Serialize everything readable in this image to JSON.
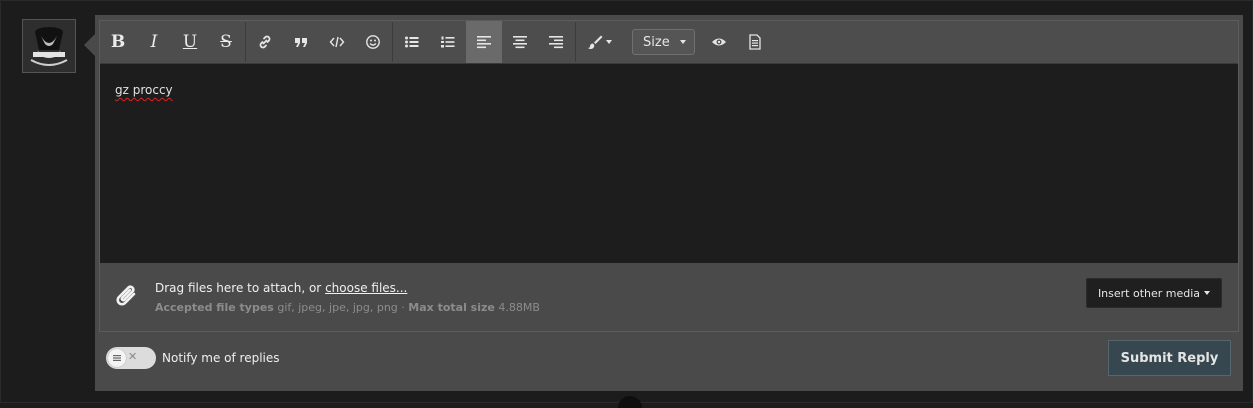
{
  "avatar": {
    "icon": "avatar-emblem"
  },
  "toolbar": {
    "bold_label": "B",
    "italic_label": "I",
    "underline_label": "U",
    "strike_label": "S",
    "size_label": "Size"
  },
  "editor": {
    "text": "gz proccy"
  },
  "attachments": {
    "drag_text": "Drag files here to attach, or ",
    "choose_link": "choose files...",
    "accepted_label": "Accepted file types",
    "accepted_types": "gif, jpeg, jpe, jpg, png",
    "separator": " · ",
    "max_label": "Max total size",
    "max_value": "4.88MB",
    "insert_media_label": "Insert other media"
  },
  "notify": {
    "label": "Notify me of replies",
    "enabled": false
  },
  "submit": {
    "label": "Submit Reply"
  },
  "colors": {
    "page_bg": "#1c1c1c",
    "panel_bg": "#4a4a4a",
    "editor_bg": "#1d1d1d",
    "submit_bg": "#36474f"
  }
}
